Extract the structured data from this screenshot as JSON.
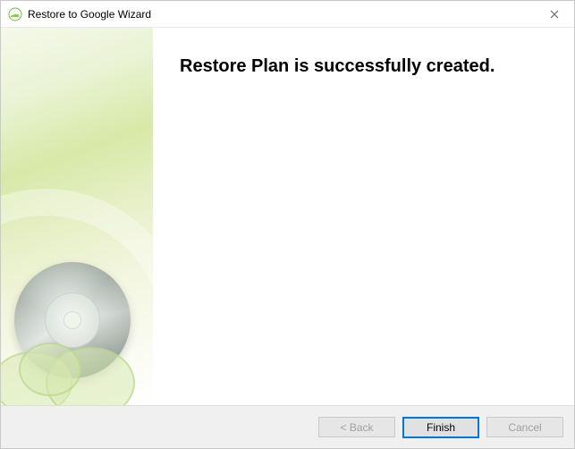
{
  "window": {
    "title": "Restore to Google Wizard"
  },
  "content": {
    "heading": "Restore Plan is successfully created."
  },
  "footer": {
    "back_label": "< Back",
    "finish_label": "Finish",
    "cancel_label": "Cancel"
  }
}
